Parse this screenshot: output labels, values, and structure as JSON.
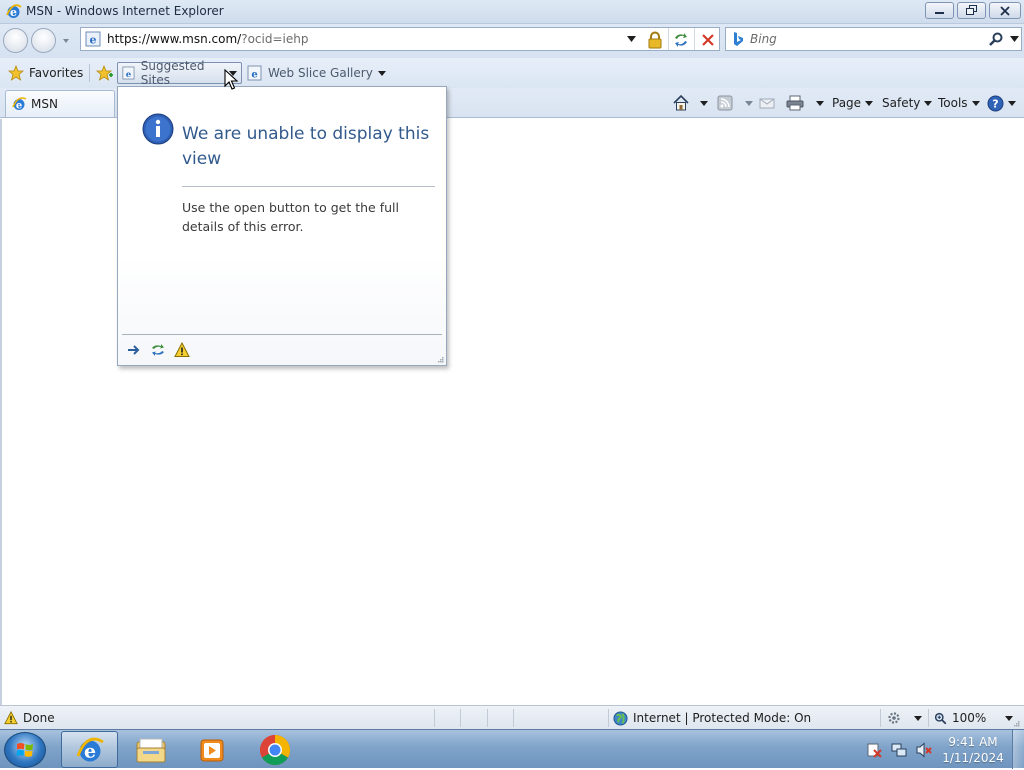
{
  "window": {
    "title": "MSN - Windows Internet Explorer",
    "minimize_icon": "minimize-icon",
    "restore_icon": "restore-icon",
    "close_icon": "close-icon"
  },
  "address": {
    "url_main": "https://www.msn.com/",
    "url_rest": "?ocid=iehp",
    "security_icon": "lock-icon"
  },
  "search": {
    "placeholder": "Bing",
    "provider_icon": "bing-icon"
  },
  "favorites_bar": {
    "favorites_label": "Favorites",
    "suggested_sites_label": "Suggested Sites",
    "web_slice_label": "Web Slice Gallery"
  },
  "tabs": [
    {
      "label": "MSN"
    }
  ],
  "command_bar": {
    "page_label": "Page",
    "safety_label": "Safety",
    "tools_label": "Tools"
  },
  "flyout": {
    "title": "We are unable to display this view",
    "body": "Use the open button to get the full details of this error.",
    "icon": "info-icon"
  },
  "status": {
    "text": "Done",
    "zone": "Internet | Protected Mode: On",
    "zoom": "100%"
  },
  "taskbar": {
    "time": "9:41 AM",
    "date": "1/11/2024",
    "apps": [
      "internet-explorer",
      "file-explorer",
      "media-player",
      "chrome"
    ]
  },
  "colors": {
    "flyout_title": "#335a8c",
    "taskbar": "#7fa3c9",
    "chrome_frame": "#dfe9f5"
  }
}
